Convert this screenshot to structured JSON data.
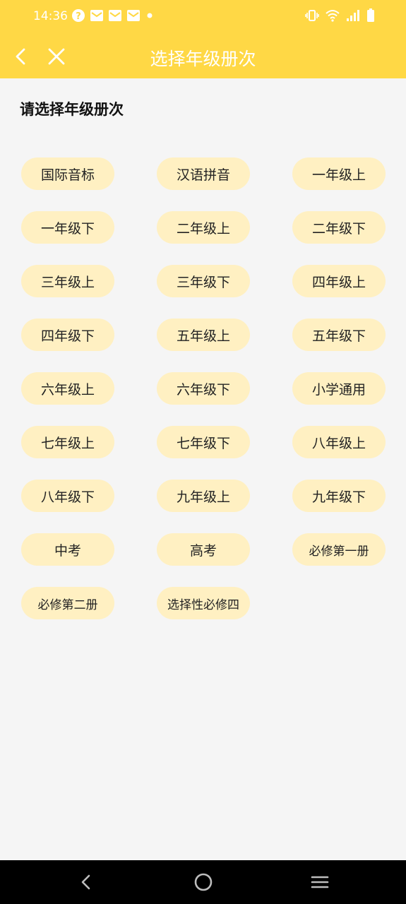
{
  "status_bar": {
    "time": "14:36",
    "left_icons": [
      "help-circle-icon",
      "mail-icon",
      "mail-icon",
      "mail-icon",
      "dot-icon"
    ],
    "right_icons": [
      "vibrate-icon",
      "wifi-icon",
      "signal-icon",
      "battery-icon"
    ]
  },
  "toolbar": {
    "title": "选择年级册次",
    "back_icon": "chevron-left-icon",
    "close_icon": "close-icon",
    "color": "#ffd845"
  },
  "heading": "请选择年级册次",
  "grades": [
    "国际音标",
    "汉语拼音",
    "一年级上",
    "一年级下",
    "二年级上",
    "二年级下",
    "三年级上",
    "三年级下",
    "四年级上",
    "四年级下",
    "五年级上",
    "五年级下",
    "六年级上",
    "六年级下",
    "小学通用",
    "七年级上",
    "七年级下",
    "八年级上",
    "八年级下",
    "九年级上",
    "九年级下",
    "中考",
    "高考",
    "必修第一册",
    "必修第二册",
    "选择性必修四"
  ],
  "chip_color": "#fff0c2",
  "nav_bar": {
    "icons": [
      "nav-back-icon",
      "nav-home-icon",
      "nav-recents-icon"
    ]
  }
}
